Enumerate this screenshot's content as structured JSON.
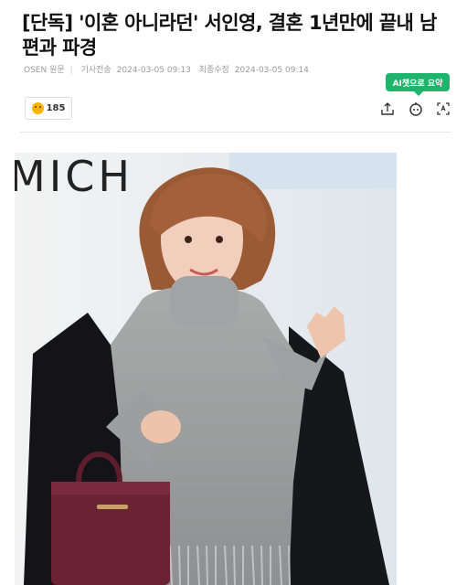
{
  "article": {
    "headline": "[단독] '이혼 아니라던' 서인영, 결혼 1년만에 끝내 남편과 파경",
    "source": "OSEN 원문",
    "published_label": "기사전송",
    "published_time": "2024-03-05 09:13",
    "modified_label": "최종수정",
    "modified_time": "2024-03-05 09:14"
  },
  "toolbar": {
    "ai_summary_label": "AI챗으로 요약",
    "reaction_count": "185",
    "icons": [
      "share-icon",
      "ai-bot-icon",
      "text-size-icon"
    ]
  },
  "photo": {
    "backdrop_text": "MICH"
  },
  "colors": {
    "ai_green": "#1fb46b",
    "text_dark": "#111111",
    "meta_gray": "#9a9a9a"
  }
}
